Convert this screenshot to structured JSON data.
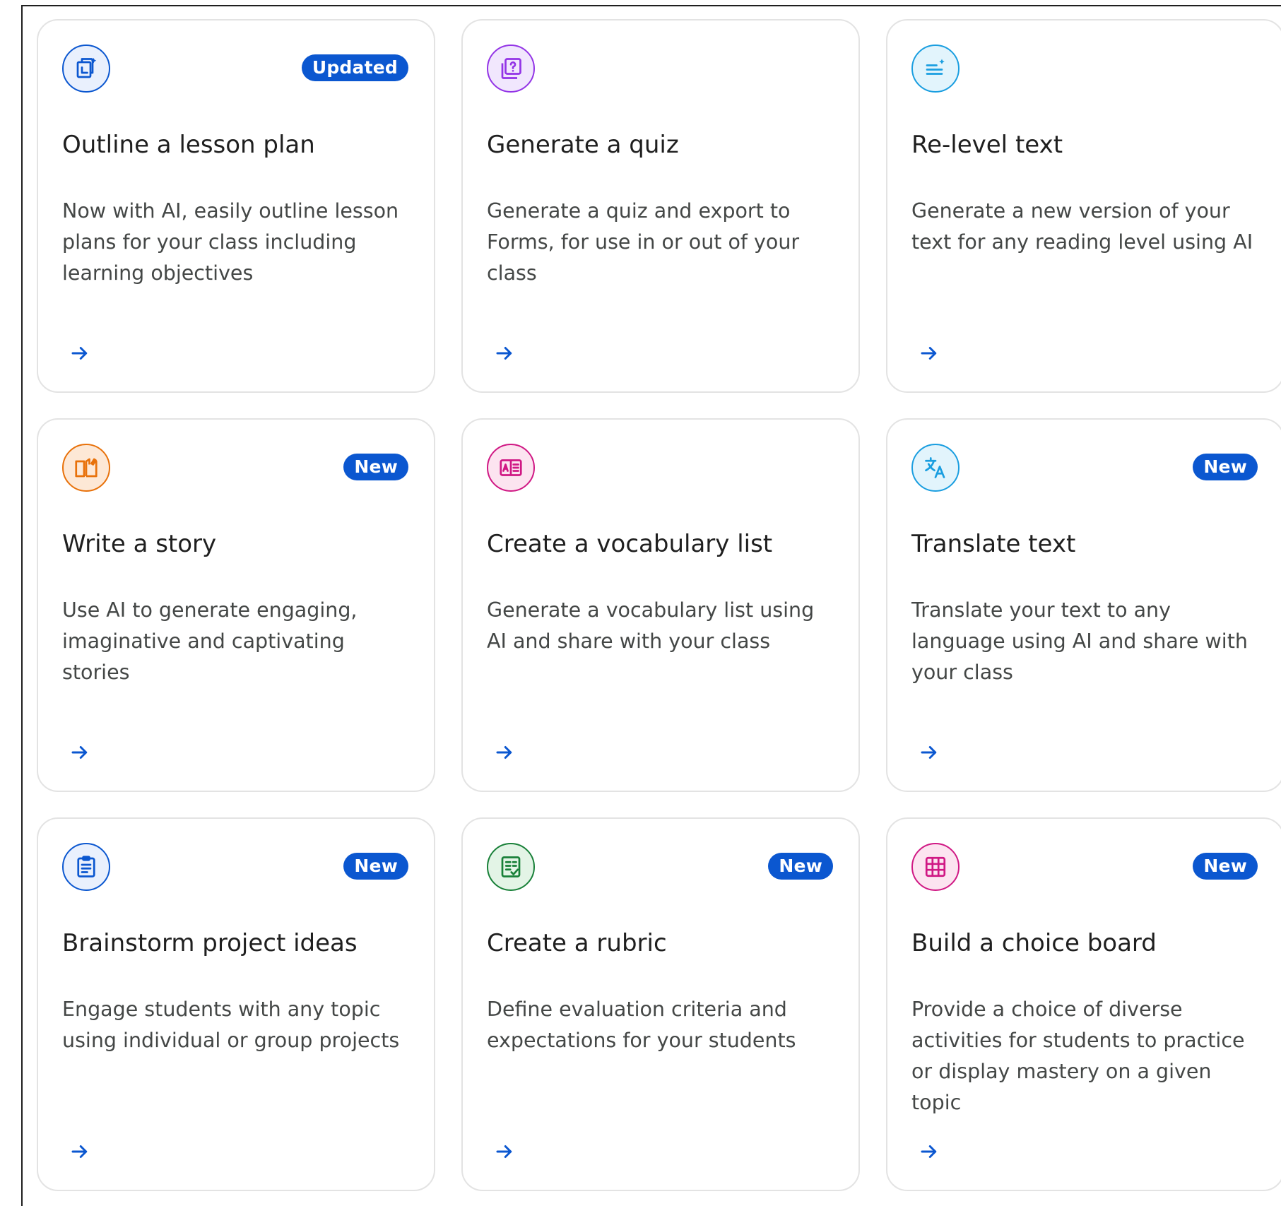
{
  "colors": {
    "badge_bg": "#0b57d0",
    "arrow": "#0b57d0",
    "title_text": "#1f1f1f",
    "desc_text": "#444746"
  },
  "cards": [
    {
      "title": "Outline a lesson plan",
      "description": "Now with AI, easily outline lesson plans for your class including learning objectives",
      "badge": "Updated",
      "icon": "lesson-plan-icon",
      "icon_color": "#0b57d0",
      "icon_bg": "#e9f0fd"
    },
    {
      "title": "Generate a quiz",
      "description": "Generate a quiz and export to Forms, for use in or out of your class",
      "badge": "",
      "icon": "quiz-icon",
      "icon_color": "#9334e6",
      "icon_bg": "#f1e7fd"
    },
    {
      "title": "Re-level text",
      "description": "Generate a new version of your text for any reading level using AI",
      "badge": "",
      "icon": "relevel-text-icon",
      "icon_color": "#1a9ee0",
      "icon_bg": "#e2f4fc"
    },
    {
      "title": "Write a story",
      "description": "Use AI to generate engaging, imaginative and captivating stories",
      "badge": "New",
      "icon": "story-book-icon",
      "icon_color": "#e8710a",
      "icon_bg": "#fde8d6"
    },
    {
      "title": "Create a vocabulary list",
      "description": "Generate a vocabulary list using AI and share with your class",
      "badge": "",
      "icon": "vocabulary-book-icon",
      "icon_color": "#d01884",
      "icon_bg": "#fce4f0"
    },
    {
      "title": "Translate text",
      "description": "Translate your text to any language using AI and share with your class",
      "badge": "New",
      "icon": "translate-icon",
      "icon_color": "#1a9ee0",
      "icon_bg": "#e2f4fc"
    },
    {
      "title": "Brainstorm project ideas",
      "description": "Engage students with any topic using individual or group projects",
      "badge": "New",
      "icon": "clipboard-icon",
      "icon_color": "#0b57d0",
      "icon_bg": "#e9f0fd"
    },
    {
      "title": "Create a rubric",
      "description": "Define evaluation criteria and expectations for your students",
      "badge": "New",
      "icon": "rubric-checklist-icon",
      "icon_color": "#188038",
      "icon_bg": "#e3f4e6"
    },
    {
      "title": "Build a choice board",
      "description": "Provide a choice of diverse activities for students to practice or display mastery on a given topic",
      "badge": "New",
      "icon": "choice-board-grid-icon",
      "icon_color": "#d01884",
      "icon_bg": "#fce4f0"
    }
  ]
}
